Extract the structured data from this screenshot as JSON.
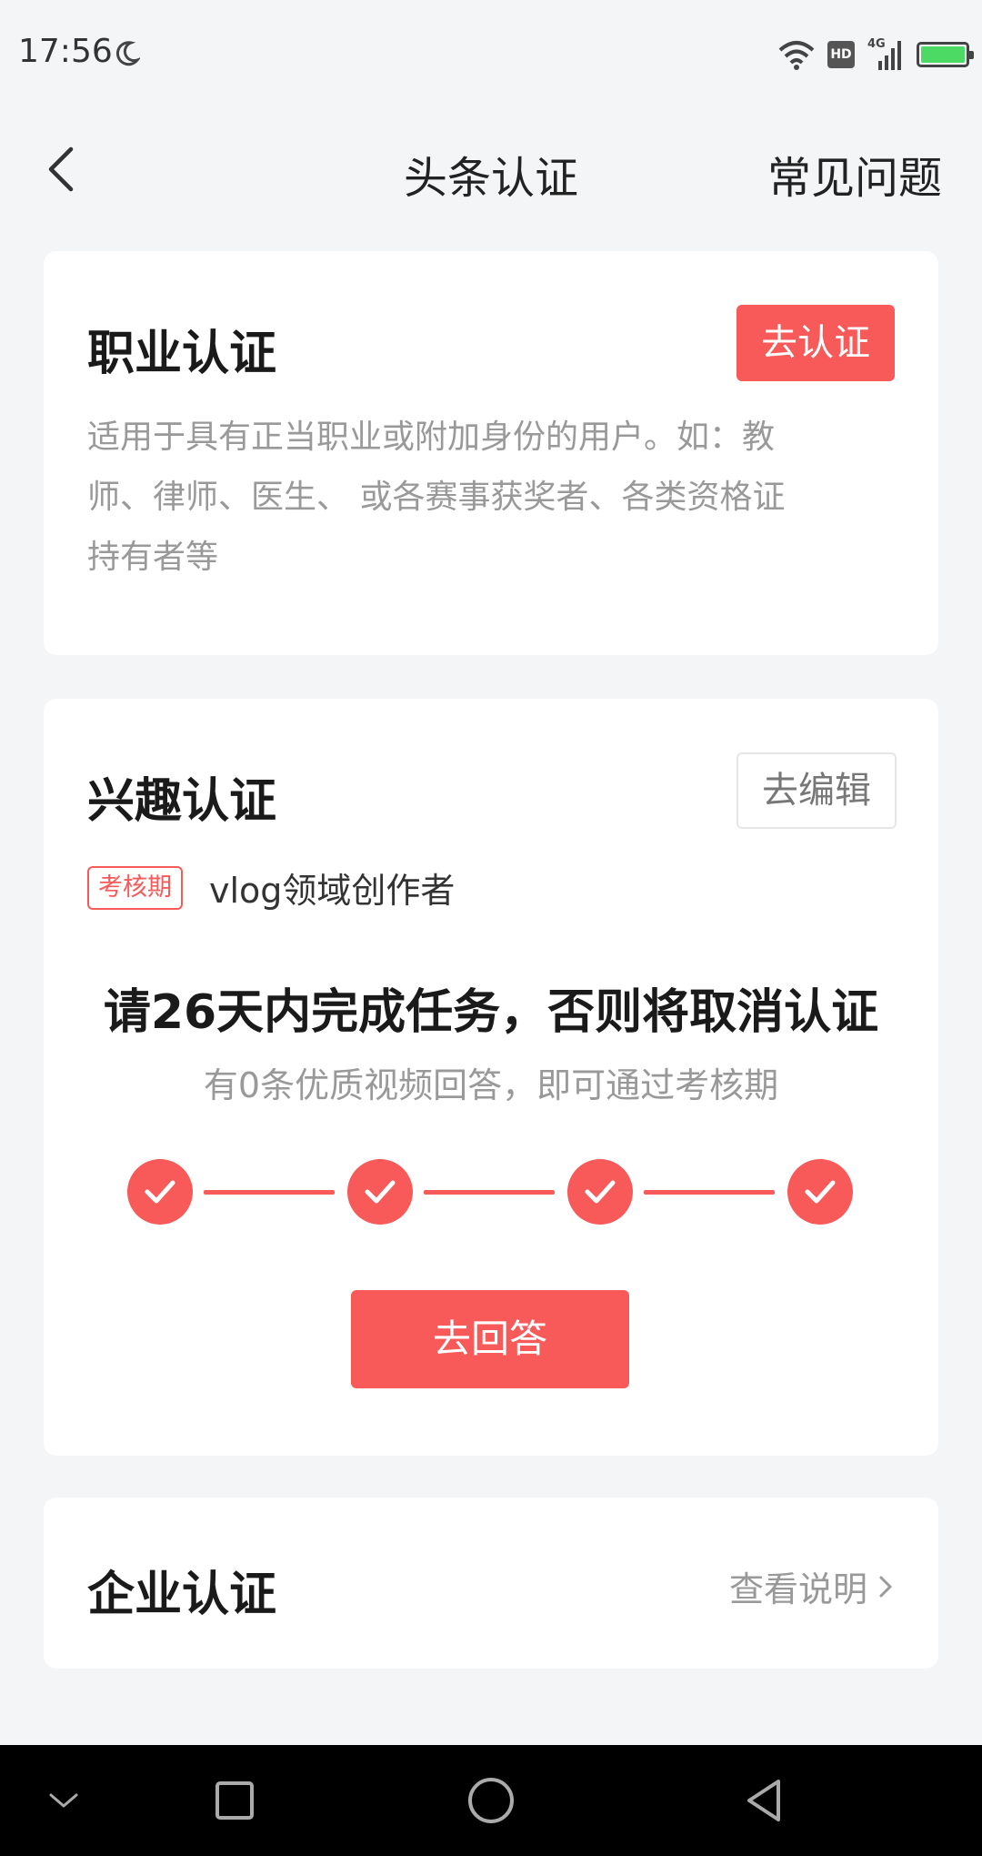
{
  "status_bar": {
    "time": "17:56",
    "icons": [
      "moon-icon",
      "wifi-icon",
      "hd-icon",
      "signal-4g-icon",
      "battery-icon"
    ],
    "hd_text": "HD",
    "net_text": "4G"
  },
  "header": {
    "title": "头条认证",
    "faq_label": "常见问题"
  },
  "cards": {
    "professional": {
      "title": "职业认证",
      "button_label": "去认证",
      "description": "适用于具有正当职业或附加身份的用户。如：教师、律师、医生、 或各赛事获奖者、各类资格证持有者等"
    },
    "interest": {
      "title": "兴趣认证",
      "edit_label": "去编辑",
      "badge": "考核期",
      "domain": "vlog领域创作者",
      "task_headline": "请26天内完成任务，否则将取消认证",
      "task_sub": "有0条优质视频回答，即可通过考核期",
      "steps_completed": 4,
      "steps_total": 4,
      "answer_button": "去回答"
    },
    "enterprise": {
      "title": "企业认证",
      "link_label": "查看说明"
    }
  },
  "colors": {
    "accent": "#f85959",
    "background": "#f4f5f7",
    "card": "#ffffff",
    "muted_text": "#999999"
  }
}
